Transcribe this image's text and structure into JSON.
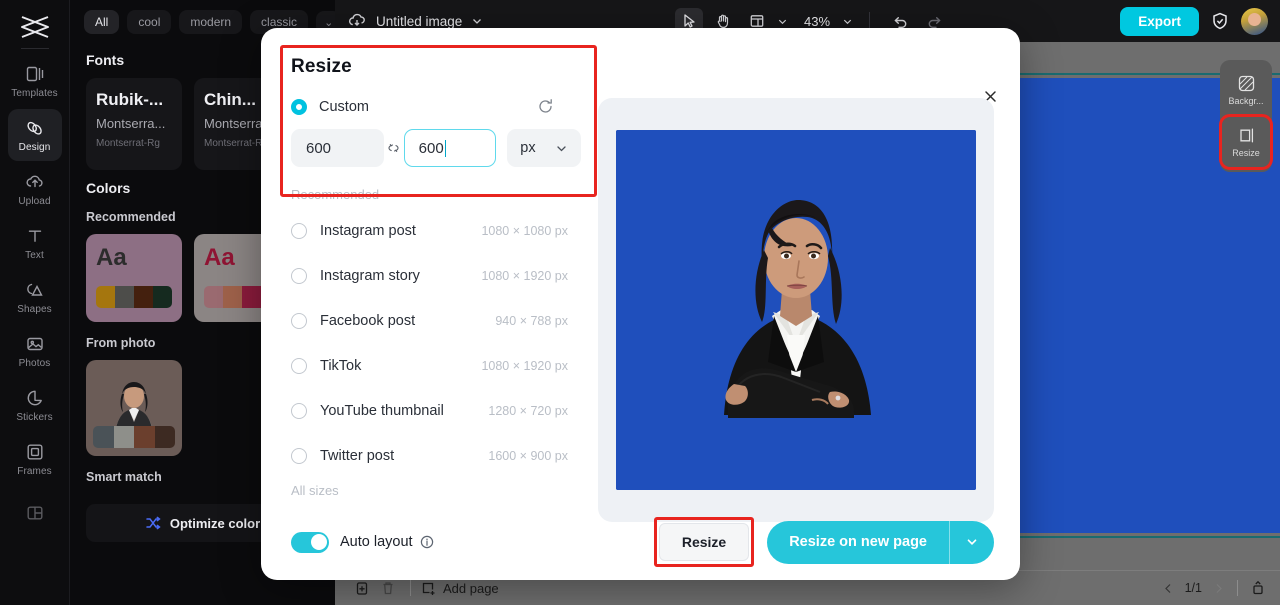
{
  "rail": {
    "logo": "capcut-logo",
    "items": [
      {
        "label": "Templates",
        "icon": "templates-icon",
        "active": false
      },
      {
        "label": "Design",
        "icon": "design-icon",
        "active": true
      },
      {
        "label": "Upload",
        "icon": "upload-icon",
        "active": false
      },
      {
        "label": "Text",
        "icon": "text-icon",
        "active": false
      },
      {
        "label": "Shapes",
        "icon": "shapes-icon",
        "active": false
      },
      {
        "label": "Photos",
        "icon": "photos-icon",
        "active": false
      },
      {
        "label": "Stickers",
        "icon": "stickers-icon",
        "active": false
      },
      {
        "label": "Frames",
        "icon": "frames-icon",
        "active": false
      }
    ]
  },
  "panel": {
    "chips": [
      {
        "label": "All",
        "active": true
      },
      {
        "label": "cool",
        "active": false
      },
      {
        "label": "modern",
        "active": false
      },
      {
        "label": "classic",
        "active": false
      }
    ],
    "fonts_heading": "Fonts",
    "font_cards": [
      {
        "line1": "Rubik-...",
        "line2": "Montserra...",
        "line3": "Montserrat-Rg"
      },
      {
        "line1": "Chin...",
        "line2": "Montserra",
        "line3": "Montserrat-Rg"
      }
    ],
    "colors_heading": "Colors",
    "colors_sub": "Recommended",
    "color_cards": [
      {
        "bg": "#8d6f84",
        "aa": "Aa",
        "aa_color": "#2c2c2c",
        "swatches": [
          "#a5760e",
          "#4d4d4a",
          "#44200e",
          "#152a1f"
        ]
      },
      {
        "bg": "#8b8584",
        "aa": "Aa",
        "aa_color": "#8f1433",
        "swatches": [
          "#9a6a70",
          "#9e614a",
          "#8b1b3c",
          "#6f2036"
        ]
      }
    ],
    "from_photo_label": "From photo",
    "photo_swatches": [
      "#4a5257",
      "#8e8f8a",
      "#6b3f2d",
      "#3d2a22"
    ],
    "smart_match_label": "Smart match",
    "optimize_label": "Optimize color"
  },
  "topbar": {
    "doc_title": "Untitled image",
    "zoom": "43%",
    "export_label": "Export",
    "icons": [
      "cloud-sync-icon",
      "chevron-down-icon",
      "cursor-select-icon",
      "hand-pan-icon",
      "layout-grid-icon",
      "undo-icon",
      "redo-icon",
      "shield-icon",
      "avatar"
    ]
  },
  "right_dock": {
    "items": [
      {
        "label": "Backgr...",
        "icon": "background-icon",
        "highlighted": false
      },
      {
        "label": "Resize",
        "icon": "resize-icon",
        "highlighted": true
      }
    ]
  },
  "bottombar": {
    "add_page_label": "Add page",
    "page_indicator": "1/1",
    "icons": [
      "duplicate-page-icon",
      "delete-page-icon",
      "add-page-icon",
      "prev-page-icon",
      "next-page-icon",
      "expand-panel-icon"
    ]
  },
  "dialog": {
    "title": "Resize",
    "close_icon": "close-icon",
    "custom": {
      "label": "Custom",
      "selected": true,
      "reset_icon": "reset-icon",
      "width_value": "600",
      "height_value": "600",
      "link_icon": "link-dimensions-icon",
      "unit_value": "px",
      "unit_caret": "chevron-down-icon"
    },
    "recommended_label": "Recommended",
    "sizes": [
      {
        "name": "Instagram post",
        "dim": "1080 × 1080 px",
        "selected": false
      },
      {
        "name": "Instagram story",
        "dim": "1080 × 1920 px",
        "selected": false
      },
      {
        "name": "Facebook post",
        "dim": "940 × 788 px",
        "selected": false
      },
      {
        "name": "TikTok",
        "dim": "1080 × 1920 px",
        "selected": false
      },
      {
        "name": "YouTube thumbnail",
        "dim": "1280 × 720 px",
        "selected": false
      },
      {
        "name": "Twitter post",
        "dim": "1600 × 900 px",
        "selected": false
      }
    ],
    "all_sizes_label": "All sizes",
    "footer": {
      "auto_layout_label": "Auto layout",
      "auto_layout_on": true,
      "info_icon": "info-icon",
      "resize_label": "Resize",
      "resize_new_page_label": "Resize on new page",
      "dropdown_icon": "chevron-down-icon"
    }
  },
  "colors": {
    "accent": "#26c6da",
    "highlight": "#e8241f",
    "canvas_blue": "#1f4fbc",
    "export_button": "#00c8e0"
  }
}
